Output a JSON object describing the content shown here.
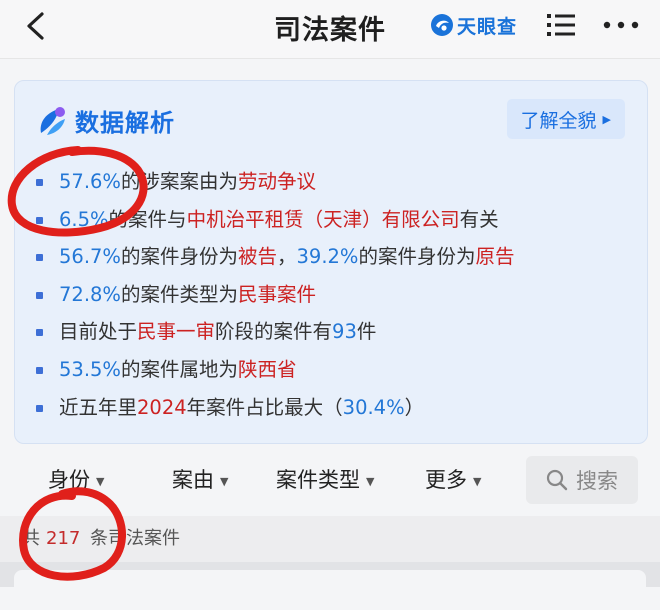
{
  "header": {
    "title": "司法案件",
    "brand": "天眼查"
  },
  "analysis": {
    "heading": "数据解析",
    "learn_more": "了解全貌",
    "items": [
      {
        "parts": [
          {
            "t": "57.6%",
            "c": "b"
          },
          {
            "t": "的涉案案由为"
          },
          {
            "t": "劳动争议",
            "c": "r"
          }
        ]
      },
      {
        "parts": [
          {
            "t": "6.5%",
            "c": "b"
          },
          {
            "t": "的案件与"
          },
          {
            "t": "中机治平租赁（天津）有限公司",
            "c": "r"
          },
          {
            "t": "有关"
          }
        ]
      },
      {
        "parts": [
          {
            "t": "56.7%",
            "c": "b"
          },
          {
            "t": "的案件身份为"
          },
          {
            "t": "被告",
            "c": "r"
          },
          {
            "t": "，"
          },
          {
            "t": "39.2%",
            "c": "b"
          },
          {
            "t": "的案件身份为"
          },
          {
            "t": "原告",
            "c": "r"
          }
        ]
      },
      {
        "parts": [
          {
            "t": "72.8%",
            "c": "b"
          },
          {
            "t": "的案件类型为"
          },
          {
            "t": "民事案件",
            "c": "r"
          }
        ]
      },
      {
        "parts": [
          {
            "t": "目前处于"
          },
          {
            "t": "民事一审",
            "c": "r"
          },
          {
            "t": "阶段的案件有"
          },
          {
            "t": "93",
            "c": "b"
          },
          {
            "t": "件"
          }
        ]
      },
      {
        "parts": [
          {
            "t": "53.5%",
            "c": "b"
          },
          {
            "t": "的案件属地为"
          },
          {
            "t": "陕西省",
            "c": "r"
          }
        ]
      },
      {
        "parts": [
          {
            "t": "近五年里"
          },
          {
            "t": "2024",
            "c": "r"
          },
          {
            "t": "年案件占比最大（"
          },
          {
            "t": "30.4%",
            "c": "b"
          },
          {
            "t": "）"
          }
        ]
      }
    ]
  },
  "filters": {
    "identity": "身份",
    "cause": "案由",
    "case_type": "案件类型",
    "more": "更多",
    "search": "搜索"
  },
  "count": {
    "prefix": "共",
    "number": "217",
    "suffix": "条司法案件"
  },
  "colors": {
    "accent_blue": "#1a6fe0",
    "value_blue": "#2377d6",
    "highlight_red": "#cc2222",
    "annotation_red": "#e0201b"
  }
}
